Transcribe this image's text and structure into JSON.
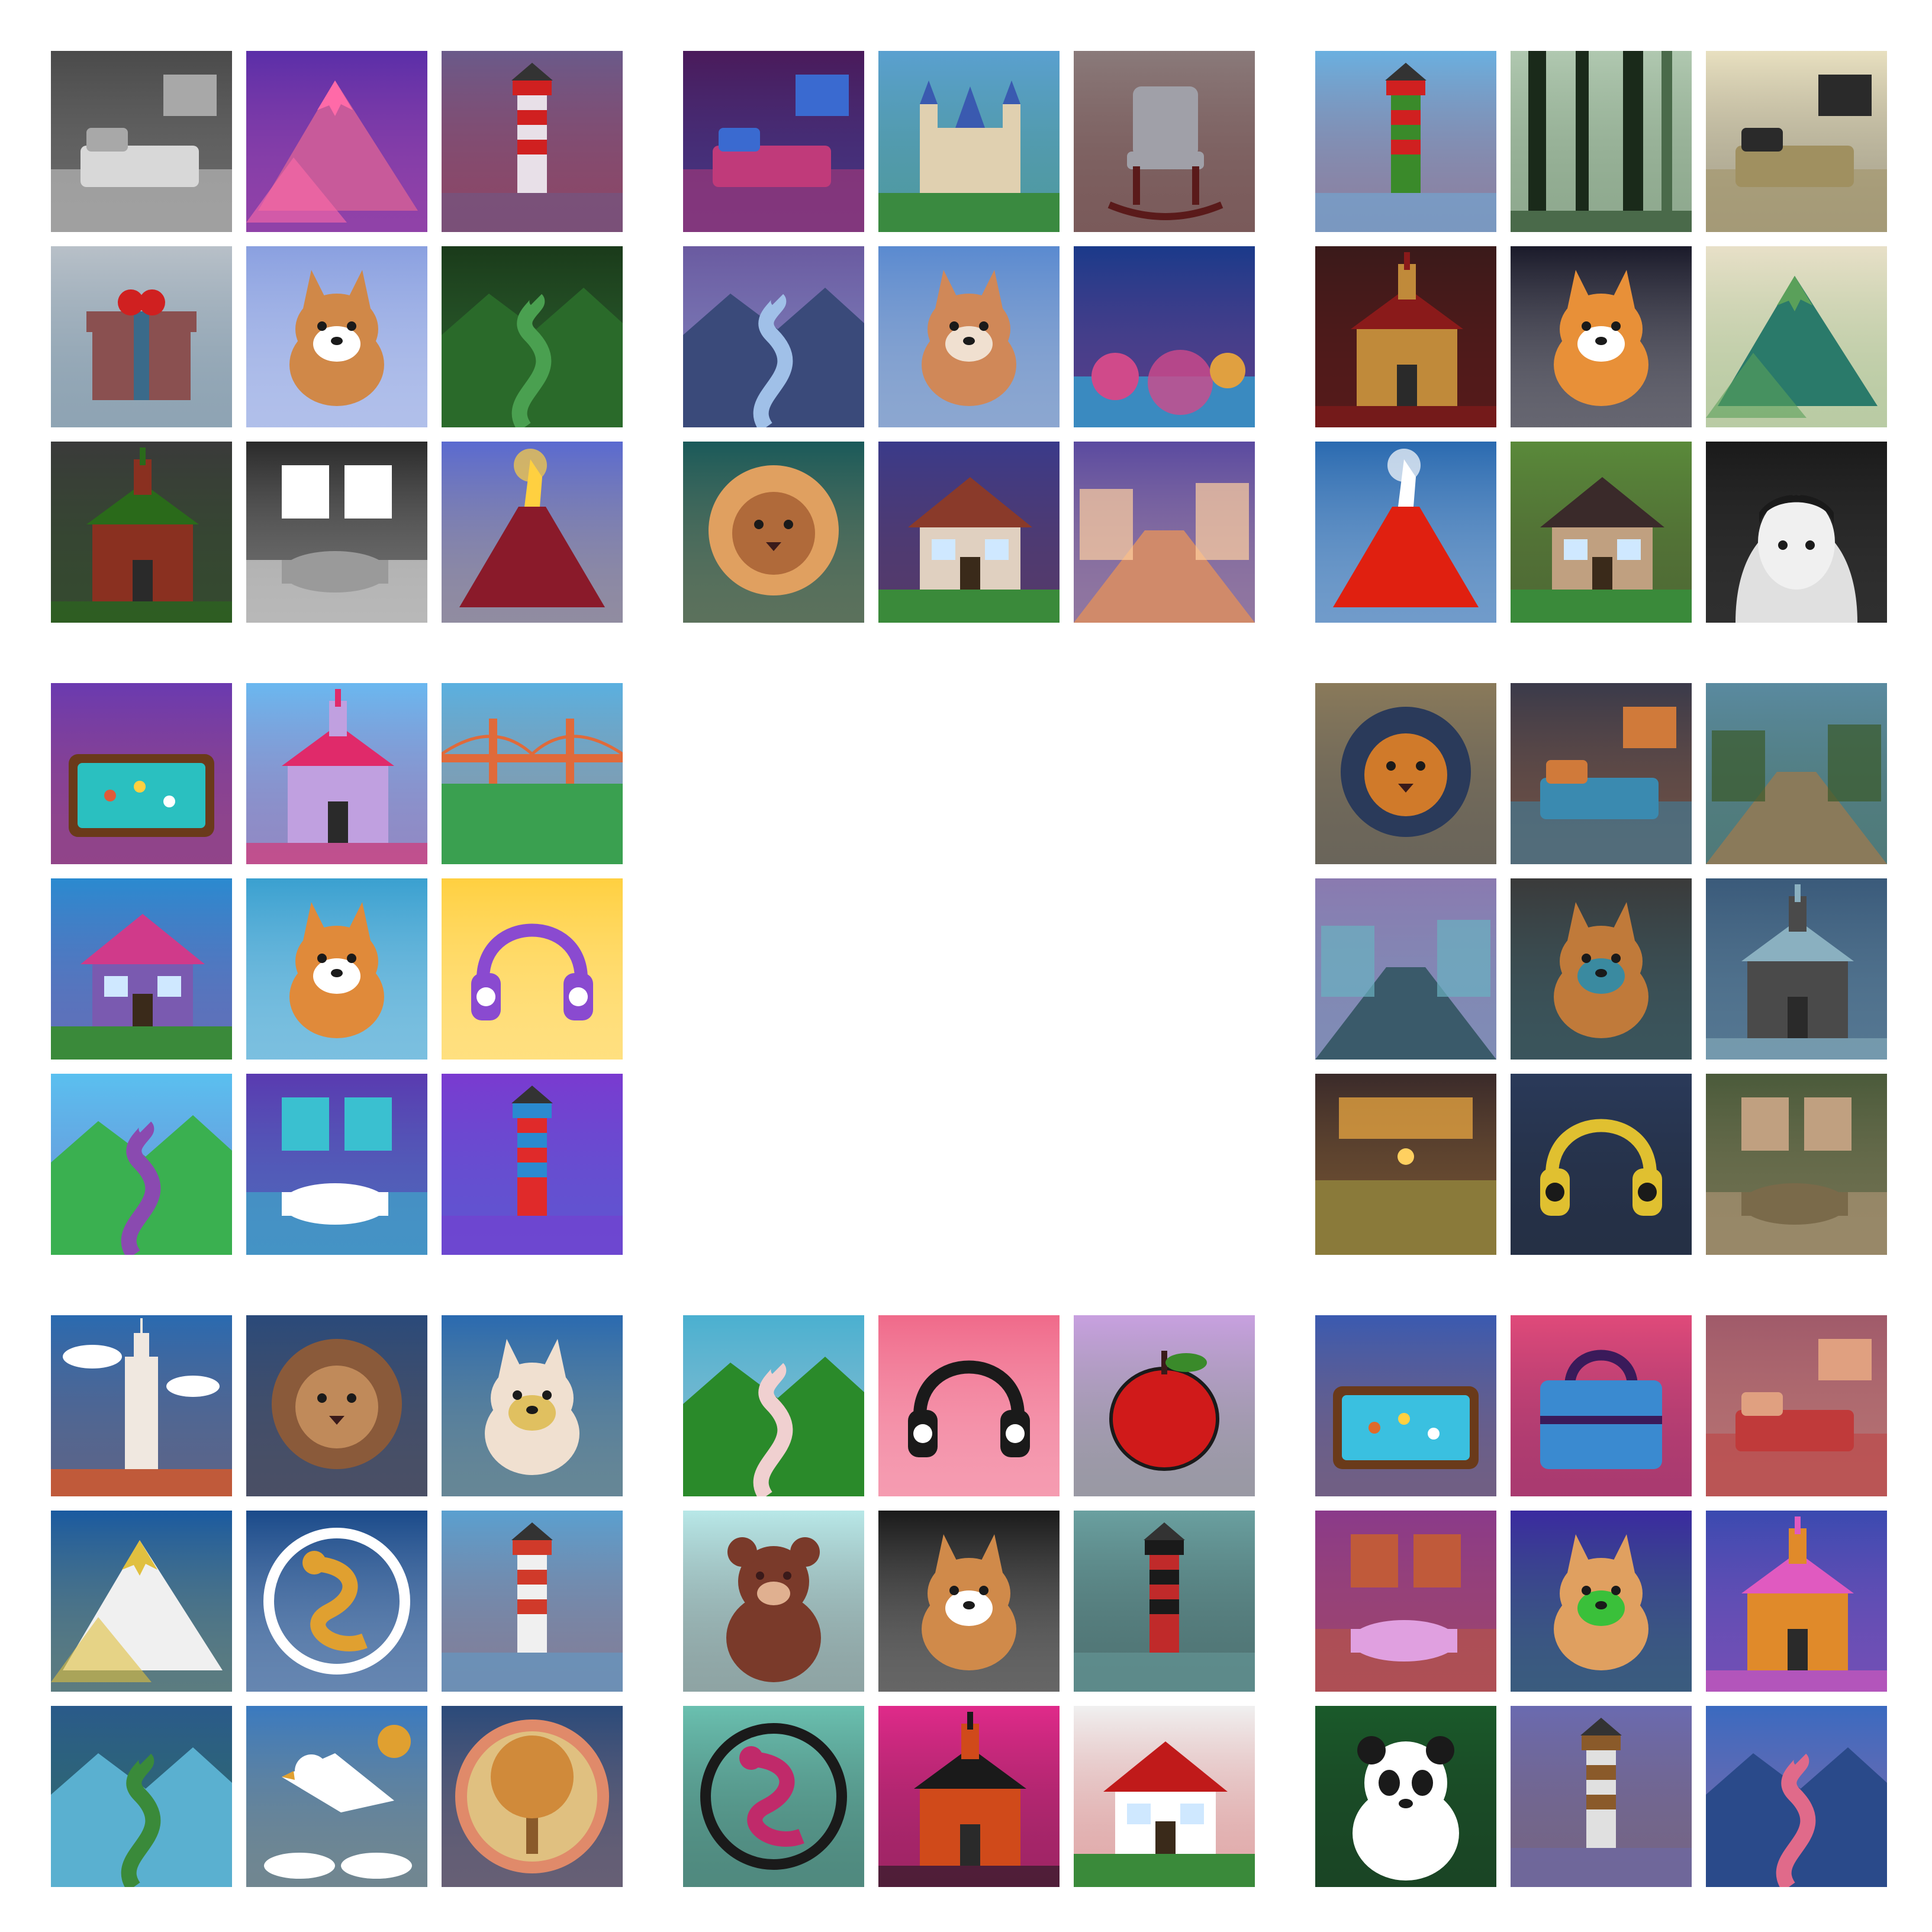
{
  "groups": [
    {
      "id": "g00",
      "style": "3d-render",
      "tiles": [
        {
          "subject": "bedroom",
          "bg": "#4a4a4a",
          "fg": "#d8d8d8",
          "accent": "#a8a8a8"
        },
        {
          "subject": "mountain",
          "bg": "#5a2ea8",
          "fg": "#c85a9a",
          "accent": "#ff6aa8"
        },
        {
          "subject": "lighthouse",
          "bg": "#6a5a8a",
          "fg": "#e8e0e8",
          "accent": "#d02020"
        },
        {
          "subject": "gift-box",
          "bg": "#b8c0c8",
          "fg": "#8a5050",
          "accent": "#3a6a8a"
        },
        {
          "subject": "corgi",
          "bg": "#8aa0e0",
          "fg": "#d08848",
          "accent": "#ffffff"
        },
        {
          "subject": "valley",
          "bg": "#1a3a1a",
          "fg": "#2a6a2a",
          "accent": "#4aa050"
        },
        {
          "subject": "church",
          "bg": "#3a3a3a",
          "fg": "#8a3020",
          "accent": "#2a6a1a"
        },
        {
          "subject": "bathroom",
          "bg": "#2a2a2a",
          "fg": "#9a9a9a",
          "accent": "#ffffff"
        },
        {
          "subject": "volcano",
          "bg": "#5a6ad0",
          "fg": "#8a1a2a",
          "accent": "#ffd040"
        }
      ]
    },
    {
      "id": "g01",
      "style": "animated-film",
      "tiles": [
        {
          "subject": "game-room",
          "bg": "#4a1a5a",
          "fg": "#c03a7a",
          "accent": "#3a6ad0"
        },
        {
          "subject": "castle",
          "bg": "#5aa0d0",
          "fg": "#e0d0b0",
          "accent": "#3a8a40"
        },
        {
          "subject": "rocking-chair",
          "bg": "#8a7a7a",
          "fg": "#a0a0a8",
          "accent": "#5a1a1a"
        },
        {
          "subject": "river-canyon",
          "bg": "#6a5aa0",
          "fg": "#3a4a7a",
          "accent": "#a0c0e8"
        },
        {
          "subject": "corgi",
          "bg": "#5a8ad0",
          "fg": "#d08858",
          "accent": "#f0e0d0"
        },
        {
          "subject": "coral-reef",
          "bg": "#1a3a8a",
          "fg": "#3a8ac0",
          "accent": "#d04a8a"
        },
        {
          "subject": "lion",
          "bg": "#1a5a5a",
          "fg": "#b06a3a",
          "accent": "#e0a060"
        },
        {
          "subject": "house",
          "bg": "#3a3a8a",
          "fg": "#e0d0c0",
          "accent": "#8a3a2a"
        },
        {
          "subject": "street",
          "bg": "#5a4aa0",
          "fg": "#d08a6a",
          "accent": "#ffd0a0"
        }
      ]
    },
    {
      "id": "g02",
      "style": "illustration",
      "tiles": [
        {
          "subject": "lighthouse",
          "bg": "#6ab0e0",
          "fg": "#3a8a2a",
          "accent": "#d02020"
        },
        {
          "subject": "forest",
          "bg": "#b0c8b0",
          "fg": "#1a2a1a",
          "accent": "#4a6a4a"
        },
        {
          "subject": "living-room",
          "bg": "#e8e0c0",
          "fg": "#a09060",
          "accent": "#2a2a2a"
        },
        {
          "subject": "temple",
          "bg": "#3a1a1a",
          "fg": "#c08a3a",
          "accent": "#8a1a1a"
        },
        {
          "subject": "corgi",
          "bg": "#1a1a2a",
          "fg": "#e89038",
          "accent": "#ffffff"
        },
        {
          "subject": "mountains",
          "bg": "#e8e0c8",
          "fg": "#2a7a6a",
          "accent": "#5aa05a"
        },
        {
          "subject": "volcano",
          "bg": "#2a6ab0",
          "fg": "#e02010",
          "accent": "#ffffff"
        },
        {
          "subject": "house",
          "bg": "#5a8a3a",
          "fg": "#c0a080",
          "accent": "#3a2a2a"
        },
        {
          "subject": "hooded-girl",
          "bg": "#1a1a1a",
          "fg": "#e0e0e0",
          "accent": "#5a5a5a"
        }
      ]
    },
    {
      "id": "g10",
      "style": "cartoon",
      "tiles": [
        {
          "subject": "pool-table",
          "bg": "#6a3ab0",
          "fg": "#2ac0c0",
          "accent": "#e05a3a"
        },
        {
          "subject": "church",
          "bg": "#6ab8f0",
          "fg": "#c0a0e0",
          "accent": "#e02a6a"
        },
        {
          "subject": "bridge",
          "bg": "#5ab0e0",
          "fg": "#3aa050",
          "accent": "#e06a3a"
        },
        {
          "subject": "house",
          "bg": "#2a8ad0",
          "fg": "#7a5ab0",
          "accent": "#d03a8a"
        },
        {
          "subject": "corgi",
          "bg": "#3aa0d0",
          "fg": "#e08a3a",
          "accent": "#ffffff"
        },
        {
          "subject": "headphones",
          "bg": "#ffd040",
          "fg": "#8a4ad0",
          "accent": "#ffffff"
        },
        {
          "subject": "river",
          "bg": "#5ac0f0",
          "fg": "#3ab050",
          "accent": "#8a4ab0"
        },
        {
          "subject": "bathroom",
          "bg": "#5a3ab0",
          "fg": "#ffffff",
          "accent": "#3ac0d0"
        },
        {
          "subject": "lighthouse",
          "bg": "#7a3ad0",
          "fg": "#e02a2a",
          "accent": "#2a8ad0"
        }
      ]
    },
    {
      "id": "g12",
      "style": "video-game",
      "tiles": [
        {
          "subject": "lion",
          "bg": "#8a7a5a",
          "fg": "#d07a2a",
          "accent": "#2a3a5a"
        },
        {
          "subject": "bedroom",
          "bg": "#3a3a4a",
          "fg": "#3a8ab0",
          "accent": "#d07a3a"
        },
        {
          "subject": "desert-town",
          "bg": "#5a8aa0",
          "fg": "#8a7a5a",
          "accent": "#3a5a2a"
        },
        {
          "subject": "ruins",
          "bg": "#8a7ab0",
          "fg": "#3a5a6a",
          "accent": "#6ab0c0"
        },
        {
          "subject": "corgi",
          "bg": "#3a3a3a",
          "fg": "#c07a3a",
          "accent": "#3a8aa0"
        },
        {
          "subject": "church",
          "bg": "#3a5a7a",
          "fg": "#4a4a4a",
          "accent": "#8ab0c0"
        },
        {
          "subject": "kitchen",
          "bg": "#3a2a2a",
          "fg": "#8a7a3a",
          "accent": "#e0a040"
        },
        {
          "subject": "headphones",
          "bg": "#2a3a5a",
          "fg": "#e0c030",
          "accent": "#1a1a1a"
        },
        {
          "subject": "bathroom",
          "bg": "#4a5a3a",
          "fg": "#7a6a4a",
          "accent": "#c0a080"
        }
      ]
    },
    {
      "id": "g20",
      "style": "paper-cut",
      "tiles": [
        {
          "subject": "skyscraper",
          "bg": "#2a6ab0",
          "fg": "#f0e8e0",
          "accent": "#c05a3a"
        },
        {
          "subject": "lion",
          "bg": "#2a4a7a",
          "fg": "#c08a5a",
          "accent": "#8a5a3a"
        },
        {
          "subject": "corgi",
          "bg": "#2a6ab0",
          "fg": "#f0e0d0",
          "accent": "#e0c060"
        },
        {
          "subject": "mountain",
          "bg": "#1a5aa0",
          "fg": "#f0f0f0",
          "accent": "#e0c040"
        },
        {
          "subject": "dragon",
          "bg": "#1a4a8a",
          "fg": "#e0a030",
          "accent": "#ffffff"
        },
        {
          "subject": "lighthouse",
          "bg": "#5aa0d0",
          "fg": "#f0f0f0",
          "accent": "#d03a2a"
        },
        {
          "subject": "landscape",
          "bg": "#2a5a8a",
          "fg": "#5ab0d0",
          "accent": "#3a8a3a"
        },
        {
          "subject": "eagle",
          "bg": "#3a7ac0",
          "fg": "#ffffff",
          "accent": "#e0a030"
        },
        {
          "subject": "tree",
          "bg": "#2a4a7a",
          "fg": "#e0c080",
          "accent": "#e08a6a"
        }
      ]
    },
    {
      "id": "g21",
      "style": "flat-icon",
      "tiles": [
        {
          "subject": "river",
          "bg": "#4ab0d0",
          "fg": "#2a8a2a",
          "accent": "#f0d0d0"
        },
        {
          "subject": "headphones",
          "bg": "#f06a8a",
          "fg": "#1a1a1a",
          "accent": "#ffffff"
        },
        {
          "subject": "apple",
          "bg": "#c8a0e0",
          "fg": "#d01a1a",
          "accent": "#3a8a2a"
        },
        {
          "subject": "teddy-bear",
          "bg": "#b8e8e8",
          "fg": "#7a3a2a",
          "accent": "#3a1a1a"
        },
        {
          "subject": "corgi",
          "bg": "#1a1a1a",
          "fg": "#d08a4a",
          "accent": "#ffffff"
        },
        {
          "subject": "lighthouse",
          "bg": "#6aa0a0",
          "fg": "#c02a2a",
          "accent": "#1a1a1a"
        },
        {
          "subject": "dragon",
          "bg": "#6ac0b0",
          "fg": "#c02a6a",
          "accent": "#1a1a1a"
        },
        {
          "subject": "temple",
          "bg": "#e02a8a",
          "fg": "#d04a1a",
          "accent": "#1a1a1a"
        },
        {
          "subject": "house",
          "bg": "#f0f0f0",
          "fg": "#ffffff",
          "accent": "#c01a1a"
        }
      ]
    },
    {
      "id": "g22",
      "style": "pixel-art",
      "tiles": [
        {
          "subject": "pool-table",
          "bg": "#3a5ab0",
          "fg": "#3ac0e0",
          "accent": "#e06a2a"
        },
        {
          "subject": "handbag",
          "bg": "#e04a7a",
          "fg": "#3a8ad0",
          "accent": "#3a1a5a"
        },
        {
          "subject": "living-room",
          "bg": "#a05a6a",
          "fg": "#c03a3a",
          "accent": "#e0a080"
        },
        {
          "subject": "bathroom",
          "bg": "#8a3a8a",
          "fg": "#e0a0e0",
          "accent": "#c05a3a"
        },
        {
          "subject": "corgi",
          "bg": "#3a2aa0",
          "fg": "#e0a060",
          "accent": "#3ac03a"
        },
        {
          "subject": "church",
          "bg": "#3a4ab0",
          "fg": "#e08a2a",
          "accent": "#e05ac0"
        },
        {
          "subject": "panda",
          "bg": "#1a5a2a",
          "fg": "#ffffff",
          "accent": "#1a1a1a"
        },
        {
          "subject": "lighthouse",
          "bg": "#6a6ab0",
          "fg": "#e0e0e0",
          "accent": "#8a5a2a"
        },
        {
          "subject": "lake",
          "bg": "#3a6ac0",
          "fg": "#2a4a8a",
          "accent": "#e06a8a"
        }
      ]
    }
  ]
}
